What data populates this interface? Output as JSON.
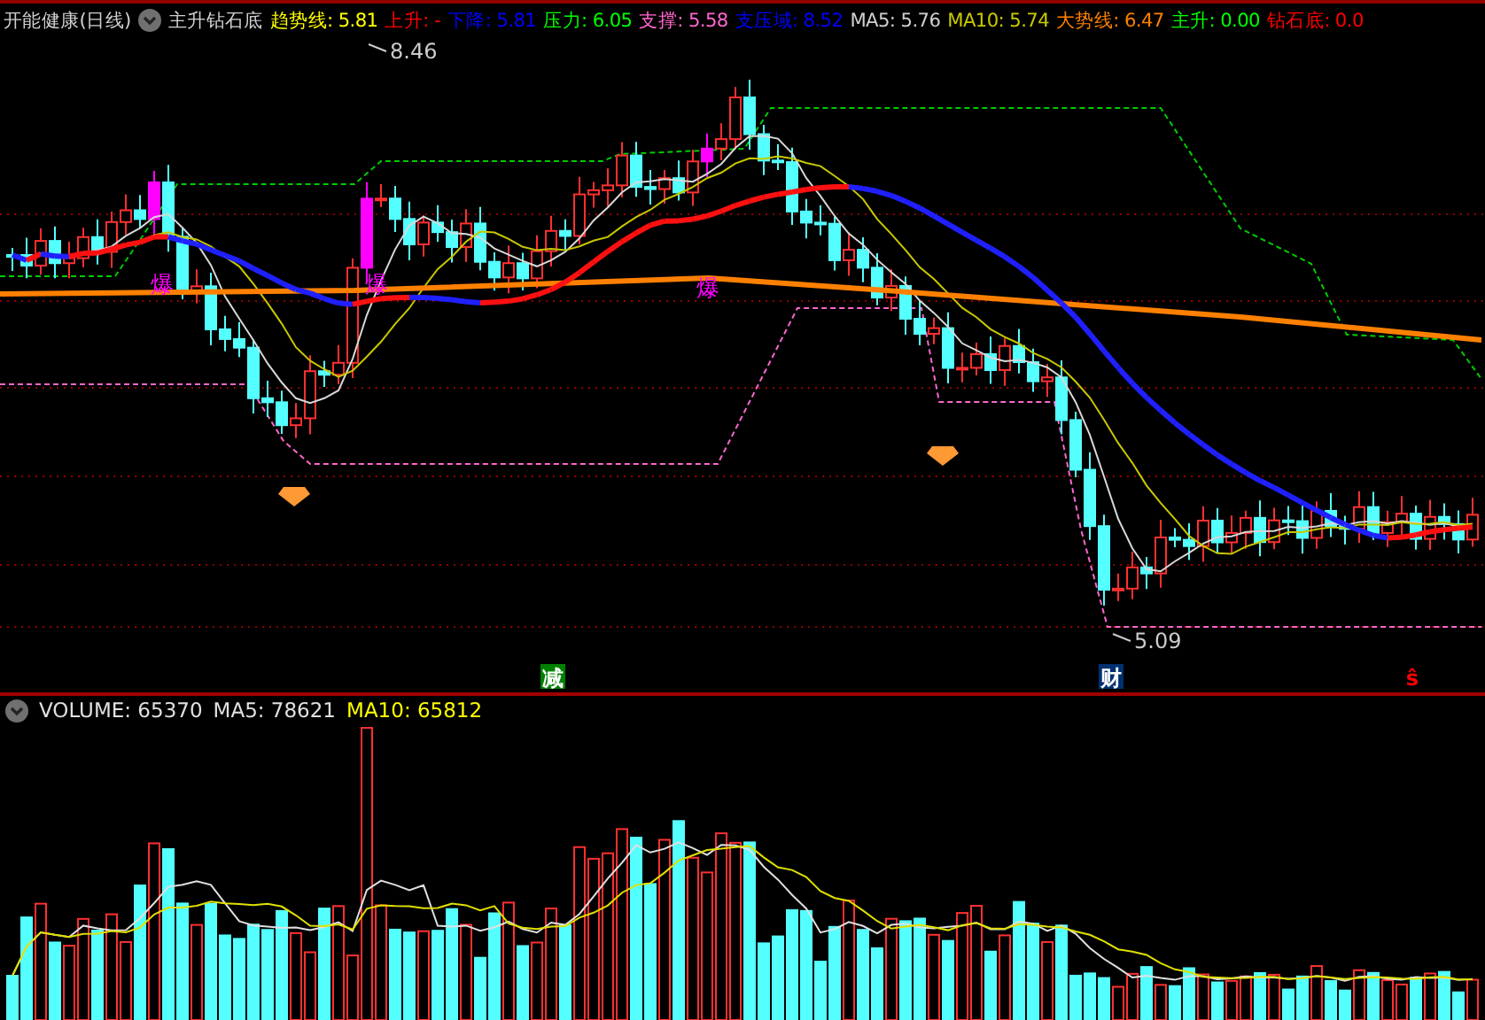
{
  "title": {
    "stock": "开能健康(日线)",
    "indicator": "主升钻石底"
  },
  "indicators": [
    {
      "label": "趋势线:",
      "value": "5.81",
      "color": "#ffff00"
    },
    {
      "label": "上升:",
      "value": "-",
      "color": "#ff0000"
    },
    {
      "label": "下降:",
      "value": "5.81",
      "color": "#0000ff"
    },
    {
      "label": "压力:",
      "value": "6.05",
      "color": "#00ff00"
    },
    {
      "label": "支撑:",
      "value": "5.58",
      "color": "#ff66cc"
    },
    {
      "label": "支压域:",
      "value": "8.52",
      "color": "#0000ff"
    },
    {
      "label": "MA5:",
      "value": "5.76",
      "color": "#d0d0d0"
    },
    {
      "label": "MA10:",
      "value": "5.74",
      "color": "#c8c800"
    },
    {
      "label": "大势线:",
      "value": "6.47",
      "color": "#ff8000"
    },
    {
      "label": "主升:",
      "value": "0.00",
      "color": "#00ff00"
    },
    {
      "label": "钻石底:",
      "value": "0.0",
      "color": "#ff0000"
    }
  ],
  "price_labels": [
    {
      "text": "8.46",
      "kind": "high"
    },
    {
      "text": "5.09",
      "kind": "low"
    }
  ],
  "chart_markers": [
    {
      "text": "爆"
    },
    {
      "text": "爆"
    },
    {
      "text": "爆"
    }
  ],
  "signals": [
    {
      "text": "减",
      "kind": "reduce"
    },
    {
      "text": "财",
      "kind": "wealth"
    },
    {
      "text": "ŝ",
      "kind": "sell"
    }
  ],
  "volume": {
    "label": "VOLUME:",
    "value": "65370",
    "ma5_label": "MA5:",
    "ma5": "78621",
    "ma10_label": "MA10:",
    "ma10": "65812"
  }
}
